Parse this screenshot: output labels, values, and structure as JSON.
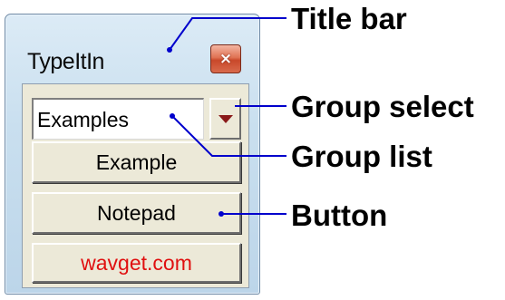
{
  "window": {
    "title": "TypeItIn",
    "close_glyph": "×",
    "group_select": {
      "value": "Examples"
    },
    "buttons": [
      {
        "label": "Example"
      },
      {
        "label": "Notepad"
      },
      {
        "label": "wavget.com",
        "color": "#e01010"
      }
    ]
  },
  "annotations": {
    "title_bar": "Title bar",
    "group_select": "Group select",
    "group_list": "Group list",
    "button": "Button"
  },
  "colors": {
    "annotation_lines": "#0000cc",
    "close_button": "#d8573a",
    "dropdown_arrow": "#8a1a1a"
  }
}
